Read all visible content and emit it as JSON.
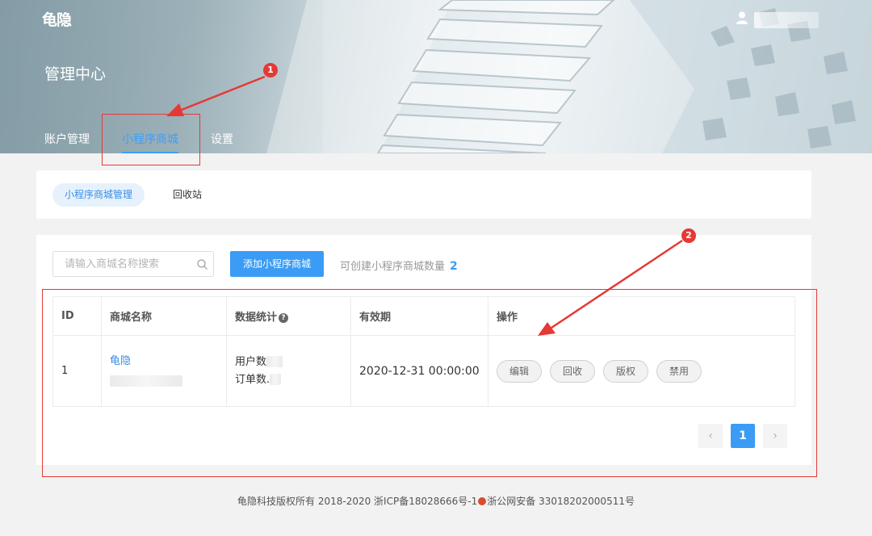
{
  "header": {
    "logo_text": "龟隐",
    "page_title": "管理中心",
    "nav": [
      {
        "label": "账户管理"
      },
      {
        "label": "小程序商城",
        "active": true
      },
      {
        "label": "设置"
      }
    ]
  },
  "subtabs": [
    {
      "label": "小程序商城管理",
      "active": true
    },
    {
      "label": "回收站"
    }
  ],
  "toolbar": {
    "search_placeholder": "请输入商城名称搜索",
    "add_button": "添加小程序商城",
    "quota_label": "可创建小程序商城数量",
    "quota_count": "2"
  },
  "table": {
    "columns": [
      "ID",
      "商城名称",
      "数据统计",
      "有效期",
      "操作"
    ],
    "rows": [
      {
        "id": "1",
        "name": "龟隐",
        "stat_users": "用户数",
        "stat_orders": "订单数.",
        "expiry": "2020-12-31 00:00:00",
        "actions": [
          "编辑",
          "回收",
          "版权",
          "禁用"
        ]
      }
    ]
  },
  "pagination": {
    "prev": "‹",
    "current": "1",
    "next": "›"
  },
  "annotations": {
    "marker_1": "1",
    "marker_2": "2"
  },
  "footer": {
    "copyright": "龟隐科技版权所有 2018-2020 浙ICP备18028666号-1",
    "police": "浙公网安备 33018202000511号"
  },
  "colors": {
    "accent": "#3a9cf5",
    "annotation": "#e53935"
  }
}
